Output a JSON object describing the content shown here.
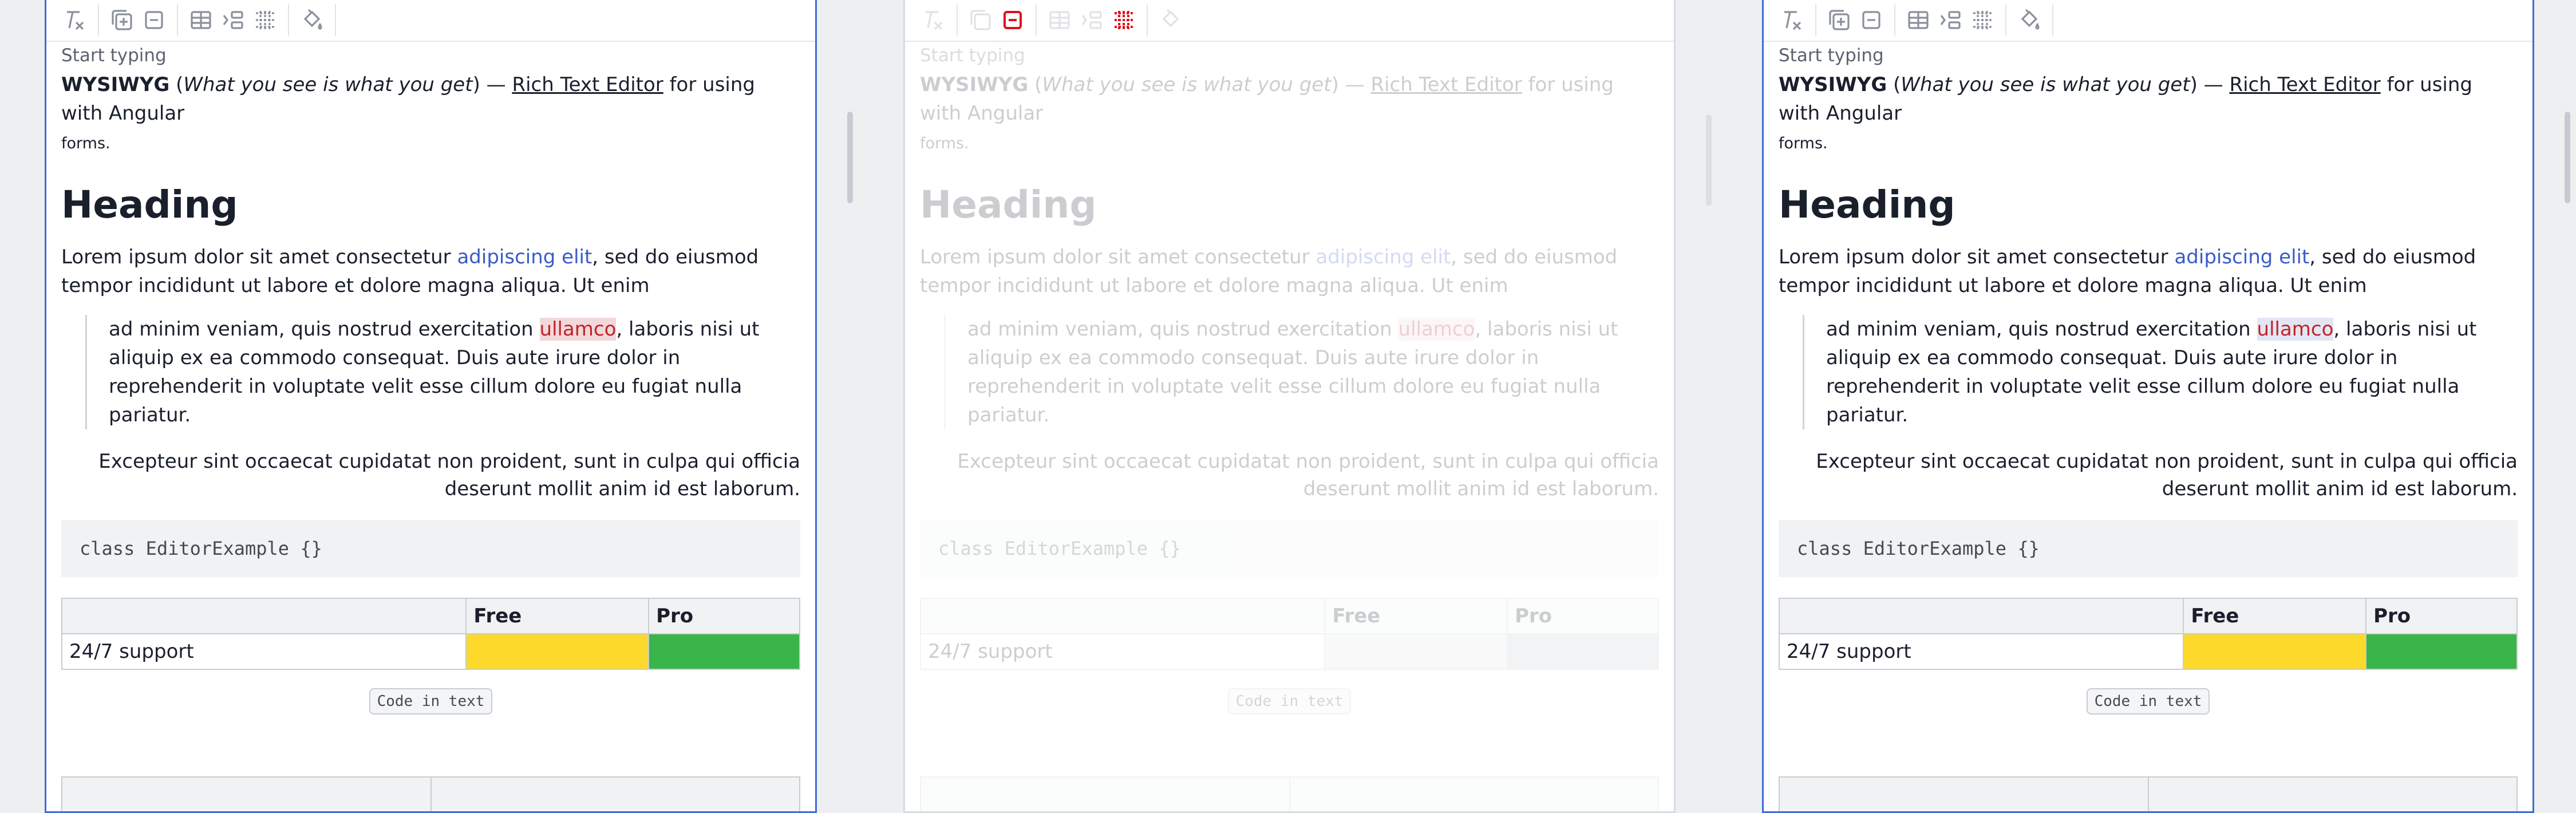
{
  "toolbar": {
    "buttons": [
      {
        "icon": "clear-format-icon"
      },
      {
        "icon": "merge-cells-icon"
      },
      {
        "icon": "remove-icon"
      },
      {
        "icon": "table-icon"
      },
      {
        "icon": "indent-icon"
      },
      {
        "icon": "table-rows-icon"
      },
      {
        "icon": "paint-bucket-icon"
      }
    ],
    "active_color": "#e0111b"
  },
  "editor": {
    "placeholder": "Start typing",
    "intro": {
      "bold": "WYSIWYG",
      "open_paren": " (",
      "italic": "What you see is what you get",
      "close_paren": ") — ",
      "link": "Rich Text Editor",
      "after_link": " for using with Angular",
      "small": "forms."
    },
    "heading": "Heading",
    "para1": {
      "before": "Lorem ipsum dolor sit amet consectetur ",
      "link": "adipiscing elit",
      "after": ", sed do eiusmod tempor incididunt ut labore et dolore magna aliqua. Ut enim"
    },
    "quote": {
      "before": "ad minim veniam, quis nostrud exercitation ",
      "highlight": "ullamco",
      "after": ", laboris nisi ut aliquip ex ea commodo consequat. Duis aute irure dolor in reprehenderit in voluptate velit esse cillum dolore eu fugiat nulla pariatur."
    },
    "right_para": "Excepteur sint occaecat cupidatat non proident, sunt in culpa qui officia deserunt mollit anim id est laborum.",
    "code_block": "class EditorExample {}",
    "table": {
      "headers": [
        "",
        "Free",
        "Pro"
      ],
      "row_label": "24/7 support",
      "colors": {
        "free": "#fcd92b",
        "pro": "#39b54a"
      }
    },
    "inline_code": "Code in text"
  },
  "colors": {
    "active_border": "#3f6ad8",
    "link": "#3a5bc7",
    "highlight": "#c0242b"
  }
}
